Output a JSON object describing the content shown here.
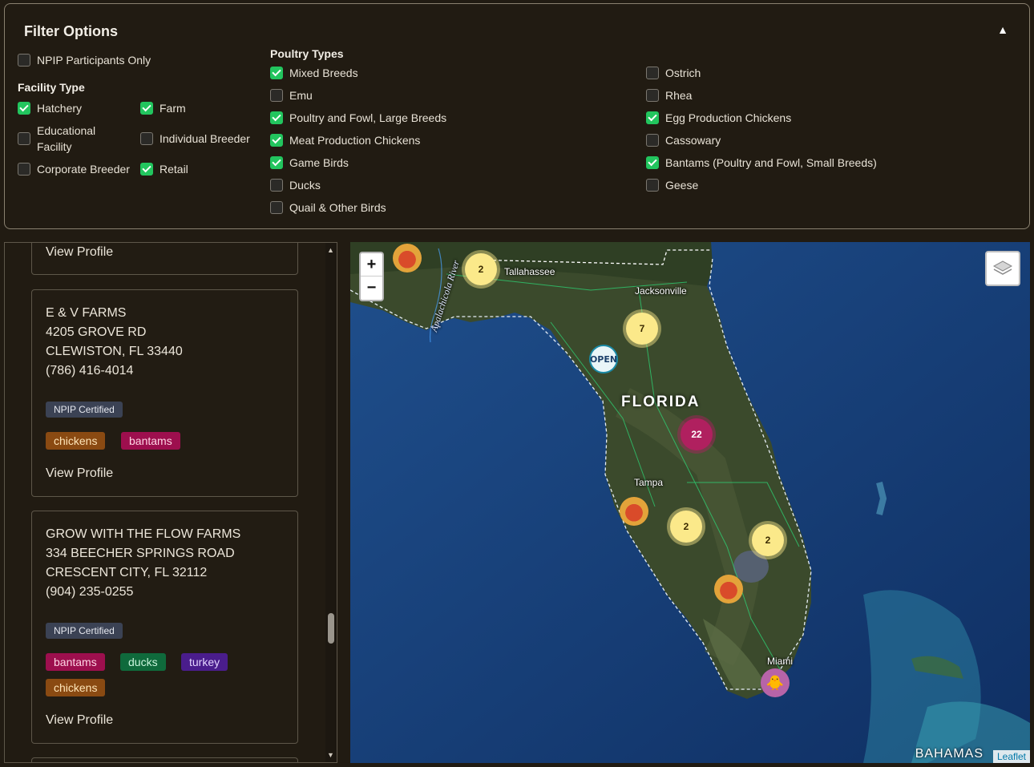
{
  "filters": {
    "title": "Filter Options",
    "collapse_icon": "▲",
    "npip_only": {
      "label": "NPIP Participants Only",
      "checked": false
    },
    "facility_type": {
      "title": "Facility Type",
      "items": [
        {
          "label": "Hatchery",
          "checked": true
        },
        {
          "label": "Farm",
          "checked": true
        },
        {
          "label": "Educational Facility",
          "checked": false
        },
        {
          "label": "Individual Breeder",
          "checked": false
        },
        {
          "label": "Corporate Breeder",
          "checked": false
        },
        {
          "label": "Retail",
          "checked": true
        }
      ]
    },
    "poultry_types": {
      "title": "Poultry Types",
      "items": [
        {
          "label": "Mixed Breeds",
          "checked": true
        },
        {
          "label": "Emu",
          "checked": false
        },
        {
          "label": "Poultry and Fowl, Large Breeds",
          "checked": true
        },
        {
          "label": "Meat Production Chickens",
          "checked": true
        },
        {
          "label": "Game Birds",
          "checked": true
        },
        {
          "label": "Ducks",
          "checked": false
        },
        {
          "label": "Quail & Other Birds",
          "checked": false
        },
        {
          "label": "Ostrich",
          "checked": false
        },
        {
          "label": "Rhea",
          "checked": false
        },
        {
          "label": "Egg Production Chickens",
          "checked": true
        },
        {
          "label": "Cassowary",
          "checked": false
        },
        {
          "label": "Bantams (Poultry and Fowl, Small Breeds)",
          "checked": true
        },
        {
          "label": "Geese",
          "checked": false
        }
      ]
    }
  },
  "listings": {
    "view_profile": "View Profile",
    "cards": [
      {
        "name": "E & V FARMS",
        "address": "4205 GROVE RD",
        "city": "CLEWISTON, FL 33440",
        "phone": "(786) 416-4014",
        "certified": "NPIP Certified",
        "tags": [
          "chickens",
          "bantams"
        ]
      },
      {
        "name": "GROW WITH THE FLOW FARMS",
        "address": "334 BEECHER SPRINGS ROAD",
        "city": "CRESCENT CITY, FL 32112",
        "phone": "(904) 235-0255",
        "certified": "NPIP Certified",
        "tags": [
          "bantams",
          "ducks",
          "turkey",
          "chickens"
        ]
      }
    ]
  },
  "map": {
    "zoom_in": "+",
    "zoom_out": "−",
    "labels": {
      "tallahassee": "Tallahassee",
      "jacksonville": "Jacksonville",
      "florida": "FLORIDA",
      "tampa": "Tampa",
      "miami": "Miami",
      "apalachicola": "Apalachicola River",
      "bahamas": "BAHAMAS"
    },
    "clusters": [
      "2",
      "7",
      "22",
      "2",
      "2"
    ],
    "open_marker": "OPEN",
    "attribution": "Leaflet",
    "colors": {
      "cluster_yellow": "#fbe98a",
      "cluster_magenta": "#b0205f"
    }
  }
}
